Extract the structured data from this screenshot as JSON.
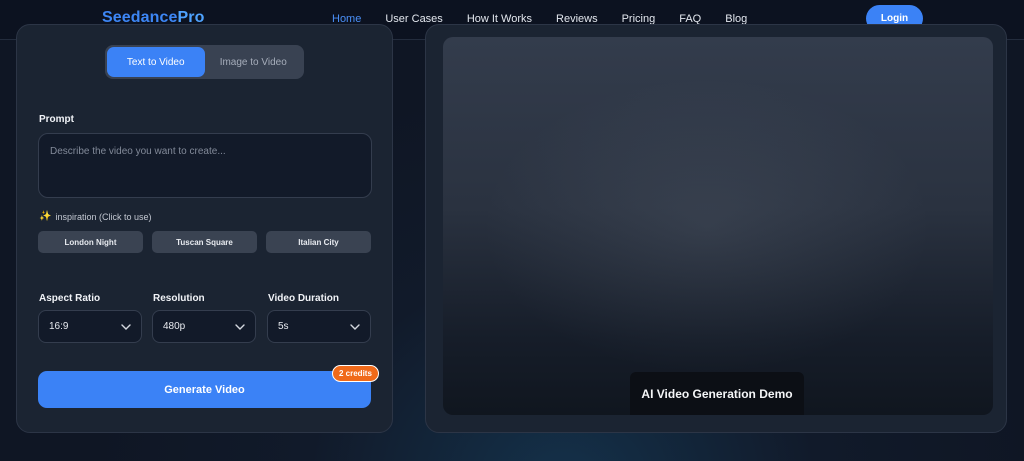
{
  "header": {
    "logo_part1": "Seedance",
    "logo_part2": "Pro",
    "nav": [
      {
        "label": "Home",
        "active": true
      },
      {
        "label": "User Cases"
      },
      {
        "label": "How It Works"
      },
      {
        "label": "Reviews"
      },
      {
        "label": "Pricing"
      },
      {
        "label": "FAQ"
      },
      {
        "label": "Blog"
      }
    ],
    "login_label": "Login"
  },
  "generator": {
    "tabs": [
      "Text to Video",
      "Image to Video"
    ],
    "active_tab": "Text to Video",
    "prompt_label": "Prompt",
    "prompt_placeholder": "Describe the video you want to create...",
    "prompt_value": "",
    "inspiration_label": "inspiration (Click to use)",
    "inspiration_chips": [
      "London Night",
      "Tuscan Square",
      "Italian City"
    ],
    "aspect_ratio": {
      "label": "Aspect Ratio",
      "value": "16:9"
    },
    "resolution": {
      "label": "Resolution",
      "value": "480p"
    },
    "duration": {
      "label": "Video Duration",
      "value": "5s"
    },
    "generate_label": "Generate Video",
    "credits_badge": "2 credits"
  },
  "preview": {
    "demo_label": "AI Video Generation Demo"
  },
  "colors": {
    "accent": "#3b82f6",
    "badge": "#f06a1a",
    "panel": "#1b2432"
  },
  "icons": {
    "sparkle": "sparkle-icon",
    "chevron": "chevron-down-icon"
  }
}
